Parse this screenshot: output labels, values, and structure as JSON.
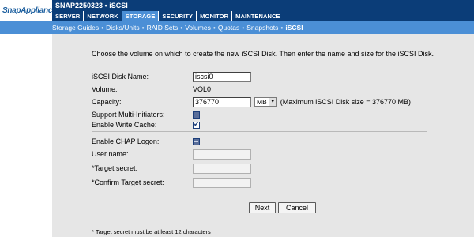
{
  "brand": {
    "logo_text": "SnapAppliance"
  },
  "title": "SNAP2250323 • iSCSI",
  "main_nav": [
    "SERVER",
    "NETWORK",
    "STORAGE",
    "SECURITY",
    "MONITOR",
    "MAINTENANCE"
  ],
  "main_nav_active": "STORAGE",
  "sub_nav": [
    "Storage Guides",
    "Disks/Units",
    "RAID Sets",
    "Volumes",
    "Quotas",
    "Snapshots",
    "iSCSI"
  ],
  "sub_nav_separator": "•",
  "intro": "Choose the volume on which to create the new iSCSI Disk. Then enter the name and size for the iSCSI Disk.",
  "form": {
    "disk_name_label": "iSCSI Disk Name:",
    "disk_name_value": "iscsi0",
    "volume_label": "Volume:",
    "volume_value": "VOL0",
    "capacity_label": "Capacity:",
    "capacity_value": "376770",
    "capacity_unit": "MB",
    "capacity_hint": "(Maximum iSCSI Disk size = 376770 MB)",
    "multi_initiators_label": "Support Multi-Initiators:",
    "multi_initiators_checked": false,
    "write_cache_label": "Enable Write Cache:",
    "write_cache_checked": true,
    "chap_label": "Enable CHAP Logon:",
    "chap_checked": false,
    "user_name_label": "User name:",
    "target_secret_label": "*Target secret:",
    "confirm_secret_label": "*Confirm Target secret:"
  },
  "buttons": {
    "next": "Next",
    "cancel": "Cancel"
  },
  "note": "* Target secret must be at least 12 characters",
  "colors": {
    "header_dark": "#0b3d78",
    "header_light": "#4b8fd6",
    "panel_bg": "#e6e6e6"
  }
}
